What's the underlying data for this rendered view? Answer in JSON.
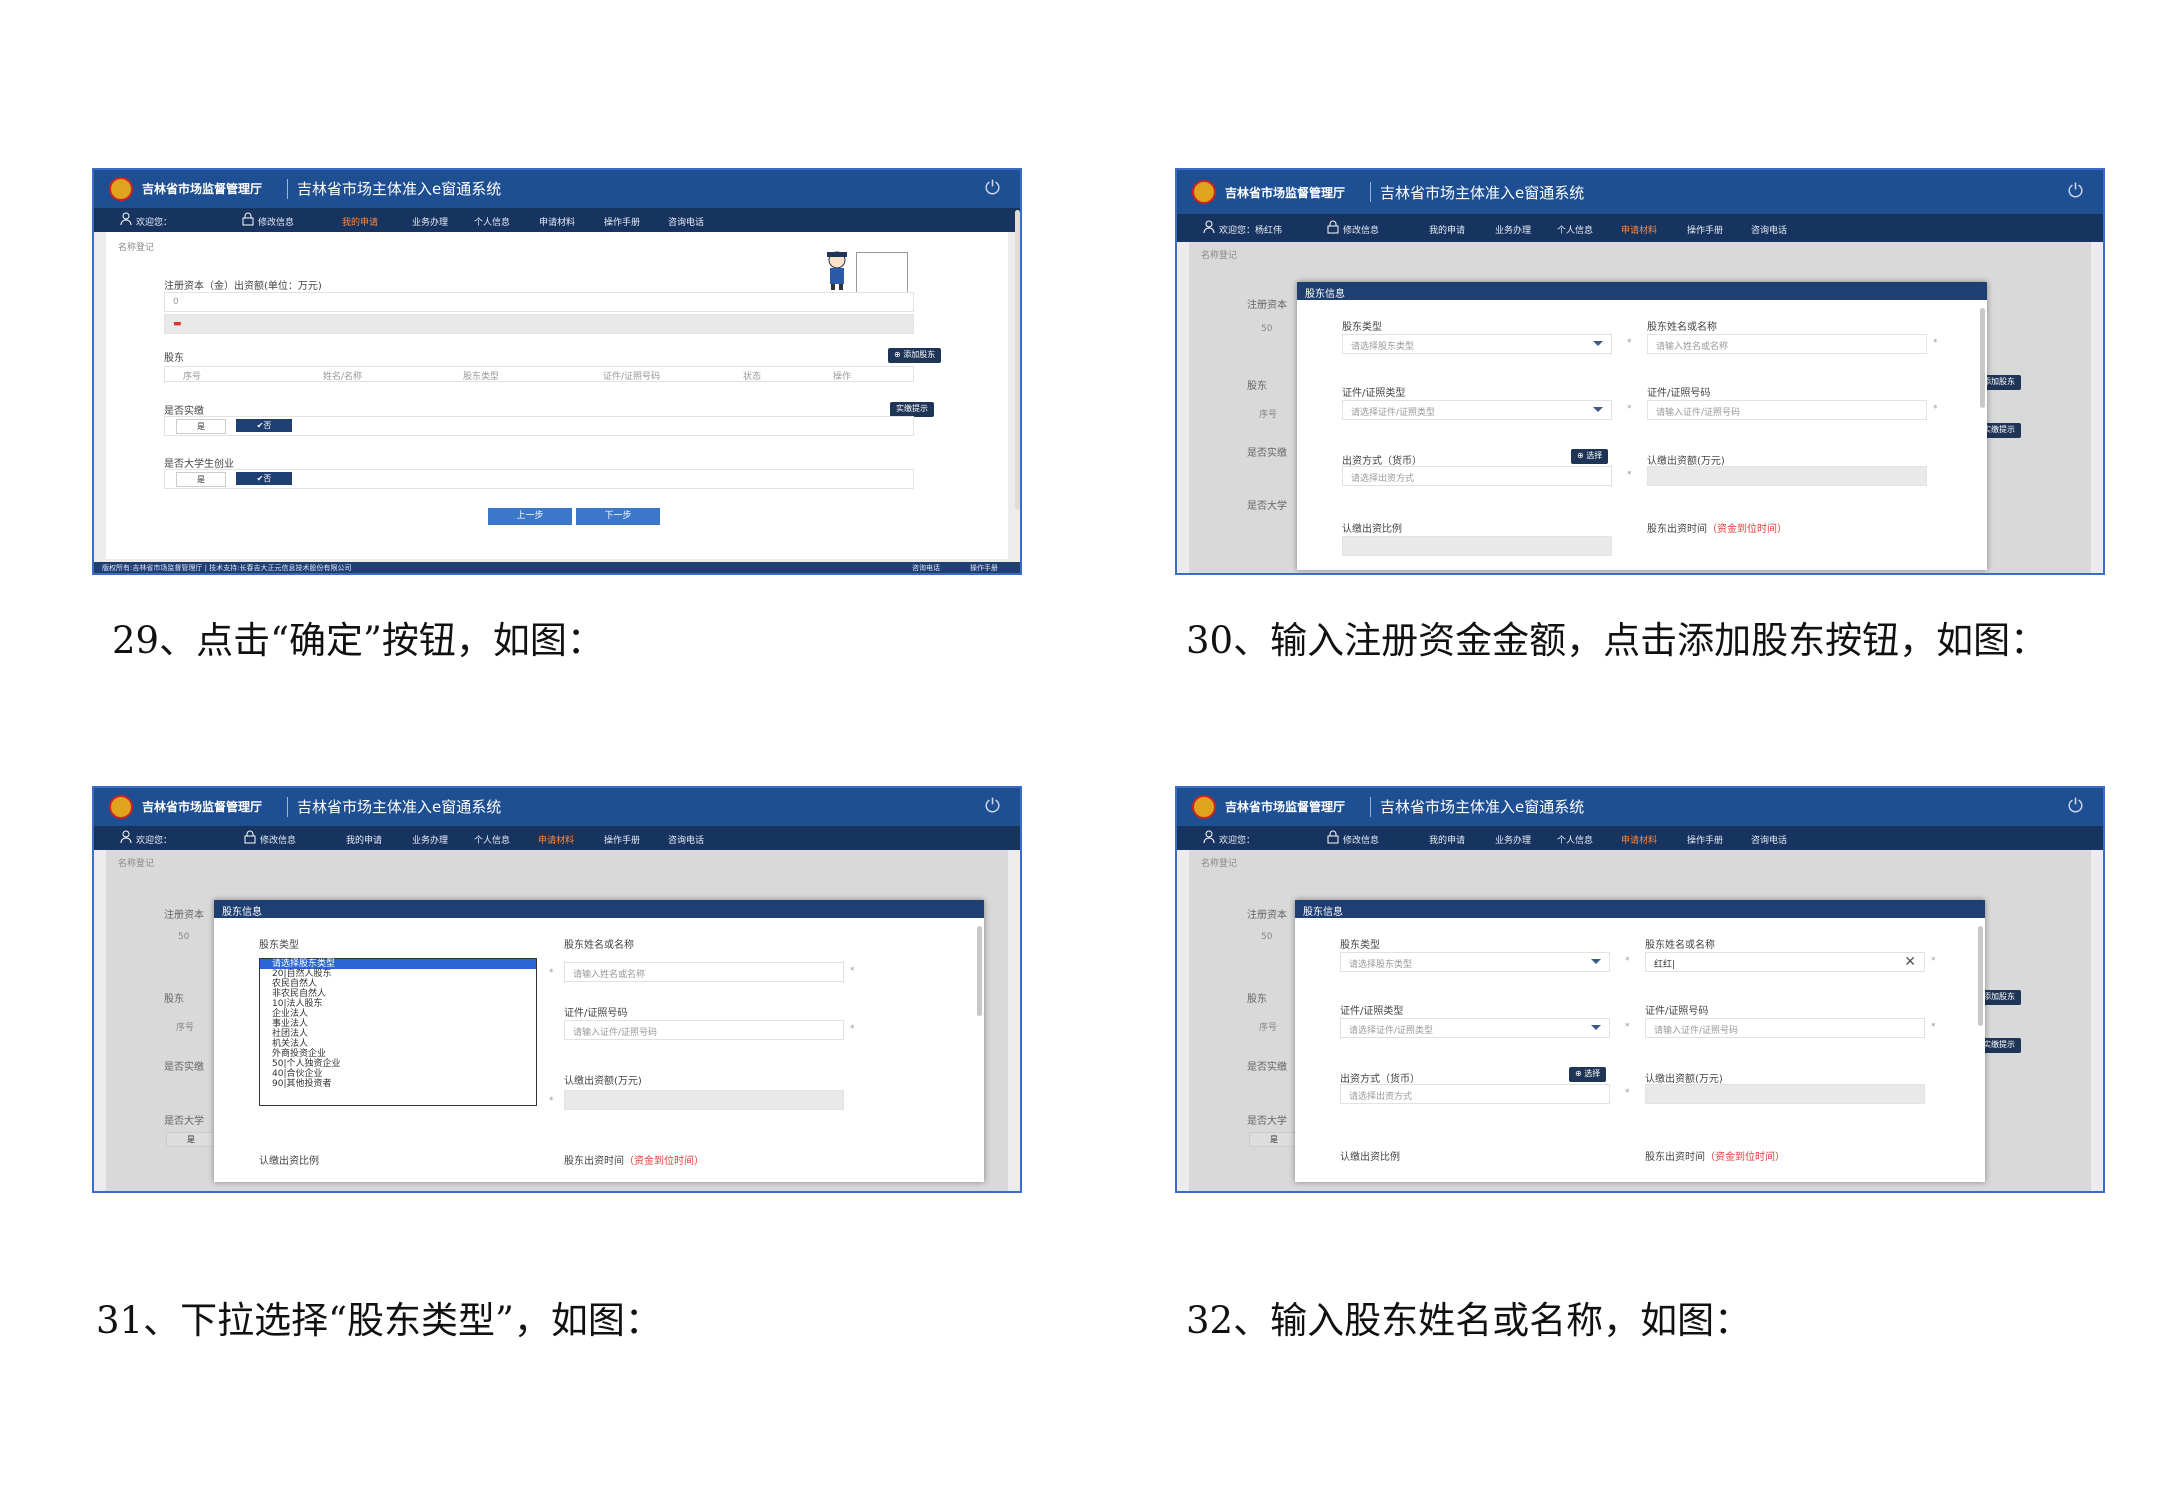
{
  "captions": {
    "c29": "29、点击“确定”按钮，如图：",
    "c30": "30、输入注册资金金额，点击添加股东按钮，如图：",
    "c31": "31、下拉选择“股东类型”，如图：",
    "c32": "32、输入股东姓名或名称，如图："
  },
  "header": {
    "org": "吉林省市场监督管理厅",
    "system": "吉林省市场主体准入e窗通系统",
    "power_icon": "power-icon"
  },
  "nav": {
    "welcome": "欢迎您：",
    "welcome_named": "欢迎您：杨红伟",
    "edit_info": "修改信息",
    "my_apps": "我的申请",
    "business": "业务办理",
    "personal": "个人信息",
    "materials": "申请材料",
    "manual": "操作手册",
    "consult": "咨询电话"
  },
  "page": {
    "section_title": "名称登记",
    "capital_label": "注册资本（金）出资额(单位：万元)",
    "capital_label_short": "注册资本",
    "capital_value_1": "0",
    "capital_value_2": "50",
    "shareholder_label": "股东",
    "add_shareholder": "添加股东",
    "columns": [
      "序号",
      "姓名/名称",
      "股东类型",
      "证件/证照号码",
      "状态",
      "操作"
    ],
    "col_seq": "序号",
    "paid_label": "是否实缴",
    "paid_label_short": "是否实缴",
    "paid_hint": "实缴提示",
    "student_label": "是否大学生创业",
    "student_label_short": "是否大学",
    "yes": "是",
    "no": "✔否",
    "prev": "上一步",
    "next": "下一步",
    "footer_left": "版权所有:吉林省市场监督管理厅 | 技术支持:长春吉大正元信息技术股份有限公司",
    "footer_right_1": "咨询电话",
    "footer_right_2": "操作手册"
  },
  "modal": {
    "title": "股东信息",
    "type_label": "股东类型",
    "type_placeholder": "请选择股东类型",
    "name_label": "股东姓名或名称",
    "name_placeholder": "请输入姓名或名称",
    "name_value": "红红|",
    "cert_type_label": "证件/证照类型",
    "cert_type_placeholder": "请选择证件/证照类型",
    "cert_no_label": "证件/证照号码",
    "cert_no_placeholder": "请输入证件/证照号码",
    "method_label": "出资方式（货币）",
    "method_placeholder": "请选择出资方式",
    "choose": "选择",
    "amount_label": "认缴出资额(万元)",
    "ratio_label": "认缴出资比例",
    "time_label": "股东出资时间",
    "time_note": "（资金到位时间）",
    "type_options": [
      "请选择股东类型",
      "20|自然人股东",
      "农民自然人",
      "非农民自然人",
      "10|法人股东",
      "企业法人",
      "事业法人",
      "社团法人",
      "机关法人",
      "外商投资企业",
      "50|个人独资企业",
      "40|合伙企业",
      "90|其他投资者"
    ]
  }
}
